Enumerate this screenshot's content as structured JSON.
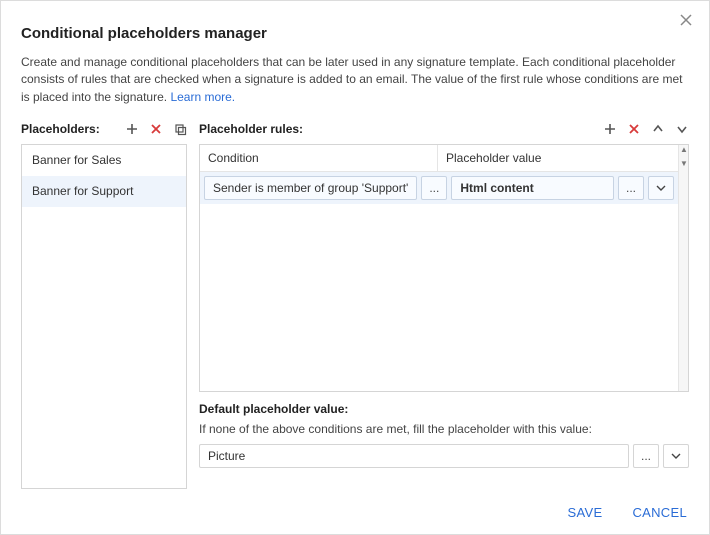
{
  "title": "Conditional placeholders manager",
  "intro_text": "Create and manage conditional placeholders that can be later used in any signature template. Each conditional placeholder consists of rules that are checked when a signature is added to an email. The value of the first rule whose conditions are met is placed into the signature. ",
  "learn_more": "Learn more.",
  "left": {
    "label": "Placeholders:",
    "items": [
      "Banner for Sales",
      "Banner for Support"
    ],
    "selected_index": 1
  },
  "right": {
    "label": "Placeholder rules:",
    "columns": {
      "condition": "Condition",
      "value": "Placeholder value"
    },
    "rows": [
      {
        "condition": "Sender is member of group 'Support'",
        "value": "Html content"
      }
    ],
    "default_label": "Default placeholder value:",
    "default_help": "If none of the above conditions are met, fill the placeholder with this value:",
    "default_value": "Picture",
    "ellipsis": "...",
    "scroll_up": "▲",
    "scroll_down": "▼"
  },
  "footer": {
    "save": "SAVE",
    "cancel": "CANCEL"
  }
}
